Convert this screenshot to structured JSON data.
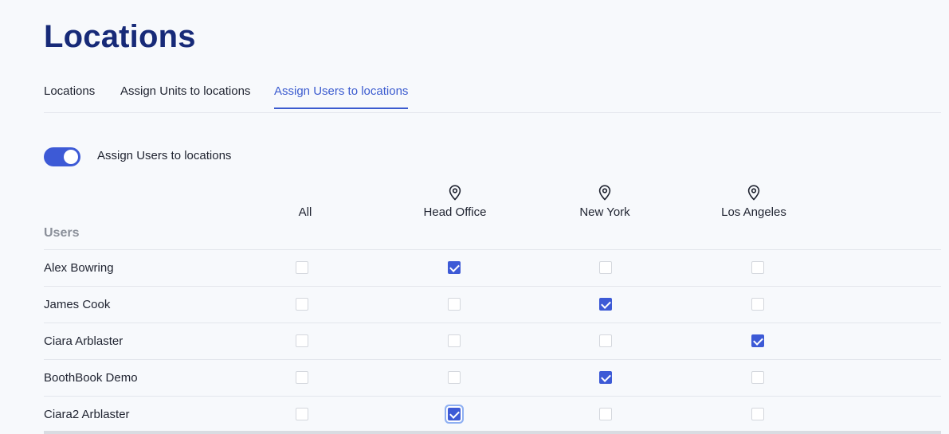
{
  "page": {
    "title": "Locations"
  },
  "tabs": [
    {
      "label": "Locations",
      "active": false
    },
    {
      "label": "Assign Units to locations",
      "active": false
    },
    {
      "label": "Assign Users to locations",
      "active": true
    }
  ],
  "toggle": {
    "label": "Assign Users to locations",
    "on": true
  },
  "columns": {
    "all": "All",
    "locations": [
      {
        "label": "Head Office",
        "icon": "map-pin-icon"
      },
      {
        "label": "New York",
        "icon": "map-pin-icon"
      },
      {
        "label": "Los Angeles",
        "icon": "map-pin-icon"
      }
    ]
  },
  "users_header": "Users",
  "users": [
    {
      "name": "Alex Bowring",
      "checks": [
        false,
        true,
        false,
        false
      ]
    },
    {
      "name": "James Cook",
      "checks": [
        false,
        false,
        true,
        false
      ]
    },
    {
      "name": "Ciara Arblaster",
      "checks": [
        false,
        false,
        false,
        true
      ]
    },
    {
      "name": "BoothBook Demo",
      "checks": [
        false,
        false,
        true,
        false
      ]
    },
    {
      "name": "Ciara2 Arblaster",
      "checks": [
        false,
        true,
        false,
        false
      ],
      "focused_col": 1
    }
  ],
  "colors": {
    "accent": "#3d5ad6",
    "title": "#172a78",
    "active_tab": "#3b5bcf"
  }
}
